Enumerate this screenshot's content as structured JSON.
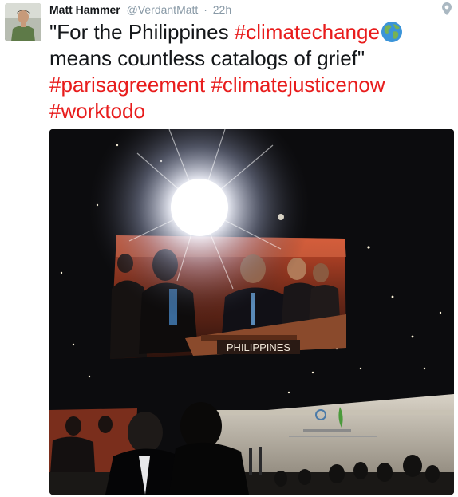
{
  "tweet": {
    "author_name": "Matt Hammer",
    "handle": "@VerdantMatt",
    "separator": "·",
    "time": "22h",
    "text_line1": "\"For the Philippines ",
    "hashtag_climatechange": "#climatechange",
    "text_line2": "means countless catalogs of grief\"",
    "hashtag_parisagreement": "#parisagreement",
    "hashtag_climatejusticenow": "#climatejusticenow",
    "hashtag_worktodo": "#worktodo"
  },
  "photo": {
    "screen_placard": "PHILIPPINES"
  },
  "icons": {
    "globe": "earth-globe-icon",
    "location": "location-pin-icon"
  },
  "colors": {
    "hashtag": "#e81c1c",
    "muted": "#8899a6",
    "name": "#14171a"
  }
}
